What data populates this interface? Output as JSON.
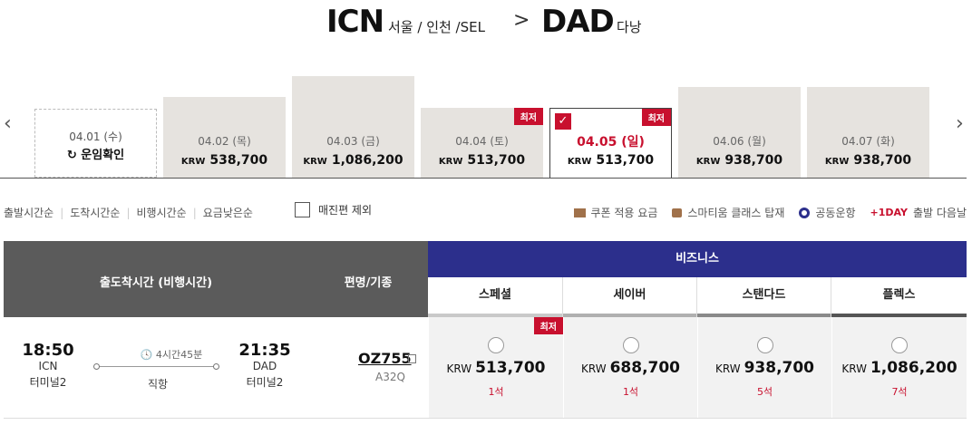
{
  "route": {
    "origin_code": "ICN",
    "origin_city": "서울 / 인천 /SEL",
    "arrow": ">",
    "dest_code": "DAD",
    "dest_city": "다낭"
  },
  "nav": {
    "prev": "‹",
    "next": "›"
  },
  "dates": [
    {
      "date": "04.01 (수)",
      "price_label": "↻ 운임확인",
      "currency": "",
      "level": 0
    },
    {
      "date": "04.02 (목)",
      "currency": "KRW",
      "price": "538,700",
      "level": 0.5
    },
    {
      "date": "04.03 (금)",
      "currency": "KRW",
      "price": "1,086,200",
      "level": 1.0
    },
    {
      "date": "04.04 (토)",
      "currency": "KRW",
      "price": "513,700",
      "level": 0.47,
      "badge": "최저"
    },
    {
      "date": "04.05 (일)",
      "currency": "KRW",
      "price": "513,700",
      "level": 0.47,
      "badge": "최저",
      "selected": true
    },
    {
      "date": "04.06 (월)",
      "currency": "KRW",
      "price": "938,700",
      "level": 0.86
    },
    {
      "date": "04.07 (화)",
      "currency": "KRW",
      "price": "938,700",
      "level": 0.86
    }
  ],
  "sort": [
    "출발시간순",
    "도착시간순",
    "비행시간순",
    "요금낮은순"
  ],
  "exclude_soldout": "매진편 제외",
  "legend": {
    "coupon": "쿠폰 적용 요금",
    "smartium": "스마티움 클래스 탑재",
    "codeshare": "공동운항",
    "oneday_tag": "+1DAY",
    "oneday_text": "출발 다음날"
  },
  "table": {
    "col_time": "출도착시간 (비행시간)",
    "col_flight": "편명/기종",
    "cabin": "비즈니스",
    "fares": [
      {
        "name": "스페셜",
        "bar": "#c9c9c9"
      },
      {
        "name": "세이버",
        "bar": "#b0b0b0"
      },
      {
        "name": "스탠다드",
        "bar": "#8a8a8a"
      },
      {
        "name": "플렉스",
        "bar": "#555555"
      }
    ]
  },
  "flight": {
    "dep_time": "18:50",
    "dep_airport": "ICN",
    "dep_terminal": "터미널2",
    "duration": "🕓 4시간45분",
    "type": "직항",
    "arr_time": "21:35",
    "arr_airport": "DAD",
    "arr_terminal": "터미널2",
    "flight_no": "OZ755",
    "aircraft": "A32Q",
    "prices": [
      {
        "currency": "KRW",
        "amount": "513,700",
        "seats": "1석",
        "badge": "최저"
      },
      {
        "currency": "KRW",
        "amount": "688,700",
        "seats": "1석"
      },
      {
        "currency": "KRW",
        "amount": "938,700",
        "seats": "5석"
      },
      {
        "currency": "KRW",
        "amount": "1,086,200",
        "seats": "7석"
      }
    ]
  },
  "colors": {
    "accent": "#c8102e",
    "cabin": "#2c2f8c",
    "header": "#5b5b5b"
  }
}
